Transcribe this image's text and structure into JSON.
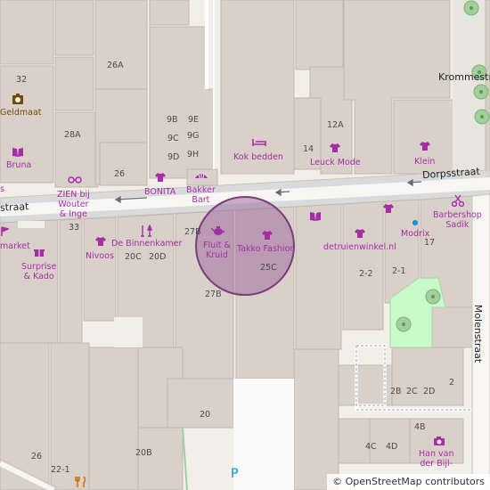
{
  "colors": {
    "building": "#d9d0c9",
    "building_outline": "#c4b6ab",
    "background": "#f2efe9",
    "road": "#f7f6f3",
    "road_edge": "#c9c4bd",
    "park": "#c8facc",
    "poi": "#a52ea5",
    "circle_fill": "#a06fa0",
    "circle_stroke": "#7b3c7b",
    "bank": "#734a08",
    "pedestrian_square": "#d8dadc",
    "bus_stop": "#0092da"
  },
  "streets": {
    "dorpsstraat_east": "Dorpsstraat",
    "dorpsstraat_west": "straat",
    "molenstraat": "Molenstraat",
    "krommestraat": "Krommestr"
  },
  "house_numbers": [
    "32",
    "26A",
    "28A",
    "26",
    "9B",
    "9E",
    "9C",
    "9G",
    "9D",
    "9H",
    "12A",
    "14",
    "33",
    "27B",
    "20C",
    "20D",
    "25C",
    "27B",
    "20",
    "20B",
    "26",
    "22-1",
    "2-2",
    "2-1",
    "2B",
    "2C",
    "2D",
    "2",
    "4B",
    "4C",
    "4D",
    "17"
  ],
  "pois": {
    "geldmaat": "Geldmaat",
    "bruna": "Bruna",
    "zien": [
      "ZIEN bij",
      "Wouter",
      "& Inge"
    ],
    "bonita": "BONITA",
    "bakker": [
      "Bakker",
      "Bart"
    ],
    "kok_bedden": "Kok bedden",
    "leuck_mode": "Leuck Mode",
    "klein": "Klein",
    "market": "market",
    "surprise": [
      "Surprise",
      "& Kado"
    ],
    "nivoos": "Nivoos",
    "binnenkamer": "De Binnenkamer",
    "fluit": [
      "Fluit &",
      "Kruid"
    ],
    "takko": "Takko Fashion",
    "detruien": "detruienwinkel.nl",
    "modrix": "Modrix",
    "barbershop": [
      "Barbershop",
      "Sadik"
    ],
    "han": [
      "Han van",
      "der Bijl-"
    ],
    "s_left": "s"
  },
  "parking": "P",
  "attribution": "© OpenStreetMap contributors"
}
